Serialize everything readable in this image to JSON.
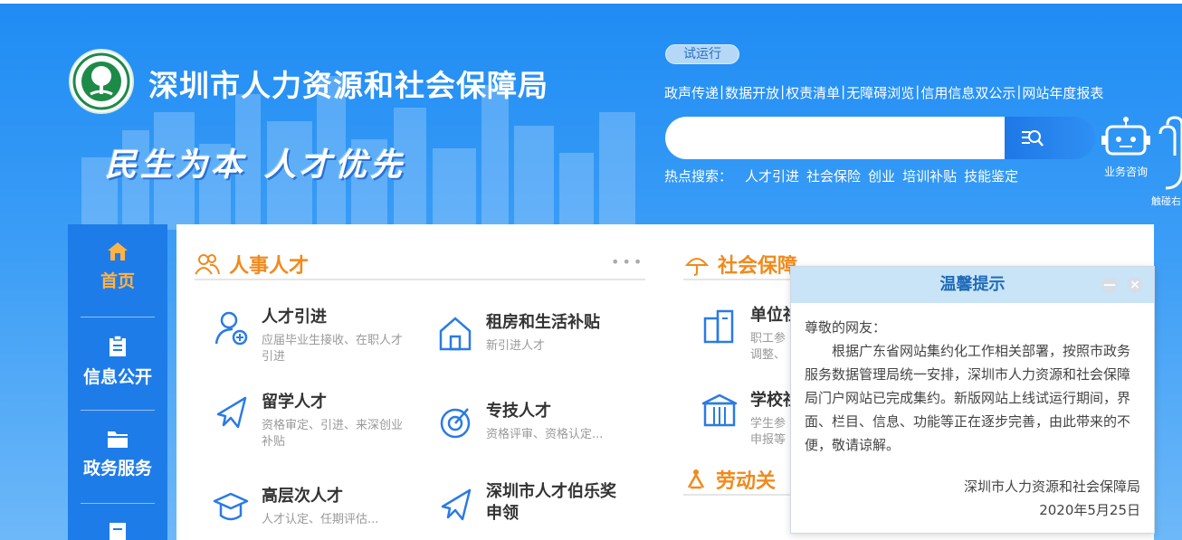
{
  "header": {
    "site_title": "深圳市人力资源和社会保障局",
    "slogan_part1": "民生为本",
    "slogan_part2": "人才优先",
    "trial_badge": "试运行",
    "top_links": [
      "政声传递",
      "数据开放",
      "权责清单",
      "无障碍浏览",
      "信用信息双公示",
      "网站年度报表"
    ],
    "search": {
      "placeholder": "",
      "value": ""
    },
    "hot_search_label": "热点搜索：",
    "hot_search": [
      "人才引进",
      "社会保险",
      "创业",
      "培训补贴",
      "技能鉴定"
    ],
    "consult_label": "业务咨询",
    "touch_label": "触碰右"
  },
  "leftnav": [
    {
      "label": "首页",
      "icon": "home-icon",
      "active": true
    },
    {
      "label": "信息公开",
      "icon": "clipboard-icon"
    },
    {
      "label": "政务服务",
      "icon": "folder-icon"
    },
    {
      "label": "",
      "icon": "document-icon"
    }
  ],
  "sections": {
    "talent": {
      "title": "人事人才",
      "icon": "people-icon",
      "items": [
        {
          "title": "人才引进",
          "desc": "应届毕业生接收、在职人才引进",
          "icon": "user-add-icon"
        },
        {
          "title": "租房和生活补贴",
          "desc": "新引进人才",
          "icon": "house-icon"
        },
        {
          "title": "留学人才",
          "desc": "资格审定、引进、来深创业补贴",
          "icon": "plane-icon"
        },
        {
          "title": "专技人才",
          "desc": "资格评审、资格认定...",
          "icon": "target-icon"
        },
        {
          "title": "高层次人才",
          "desc": "人才认定、任期评估...",
          "icon": "graduation-cap-icon"
        },
        {
          "title": "深圳市人才伯乐奖申领",
          "desc": "",
          "icon": "plane-icon"
        }
      ]
    },
    "social": {
      "title": "社会保障",
      "icon": "umbrella-icon",
      "items": [
        {
          "title": "单位社",
          "desc_l1": "职工参",
          "desc_l2": "调整、",
          "icon": "building-icon"
        },
        {
          "title": "学校社",
          "desc_l1": "学生参",
          "desc_l2": "申报等",
          "icon": "school-icon"
        }
      ]
    },
    "labor": {
      "title": "劳动关系",
      "visible_title": "劳动关",
      "icon": "labor-icon"
    }
  },
  "dialog": {
    "title": "温馨提示",
    "greeting": "尊敬的网友：",
    "body": "根据广东省网站集约化工作相关部署，按照市政务服务数据管理局统一安排，深圳市人力资源和社会保障局门户网站已完成集约。新版网站上线试运行期间，界面、栏目、信息、功能等正在逐步完善，由此带来的不便，敬请谅解。",
    "signature": "深圳市人力资源和社会保障局",
    "date": "2020年5月25日",
    "minimize": "—",
    "close": "×"
  },
  "colors": {
    "accent_blue": "#1e7ce8",
    "section_orange": "#f08a1c",
    "icon_blue": "#2a7be4"
  }
}
